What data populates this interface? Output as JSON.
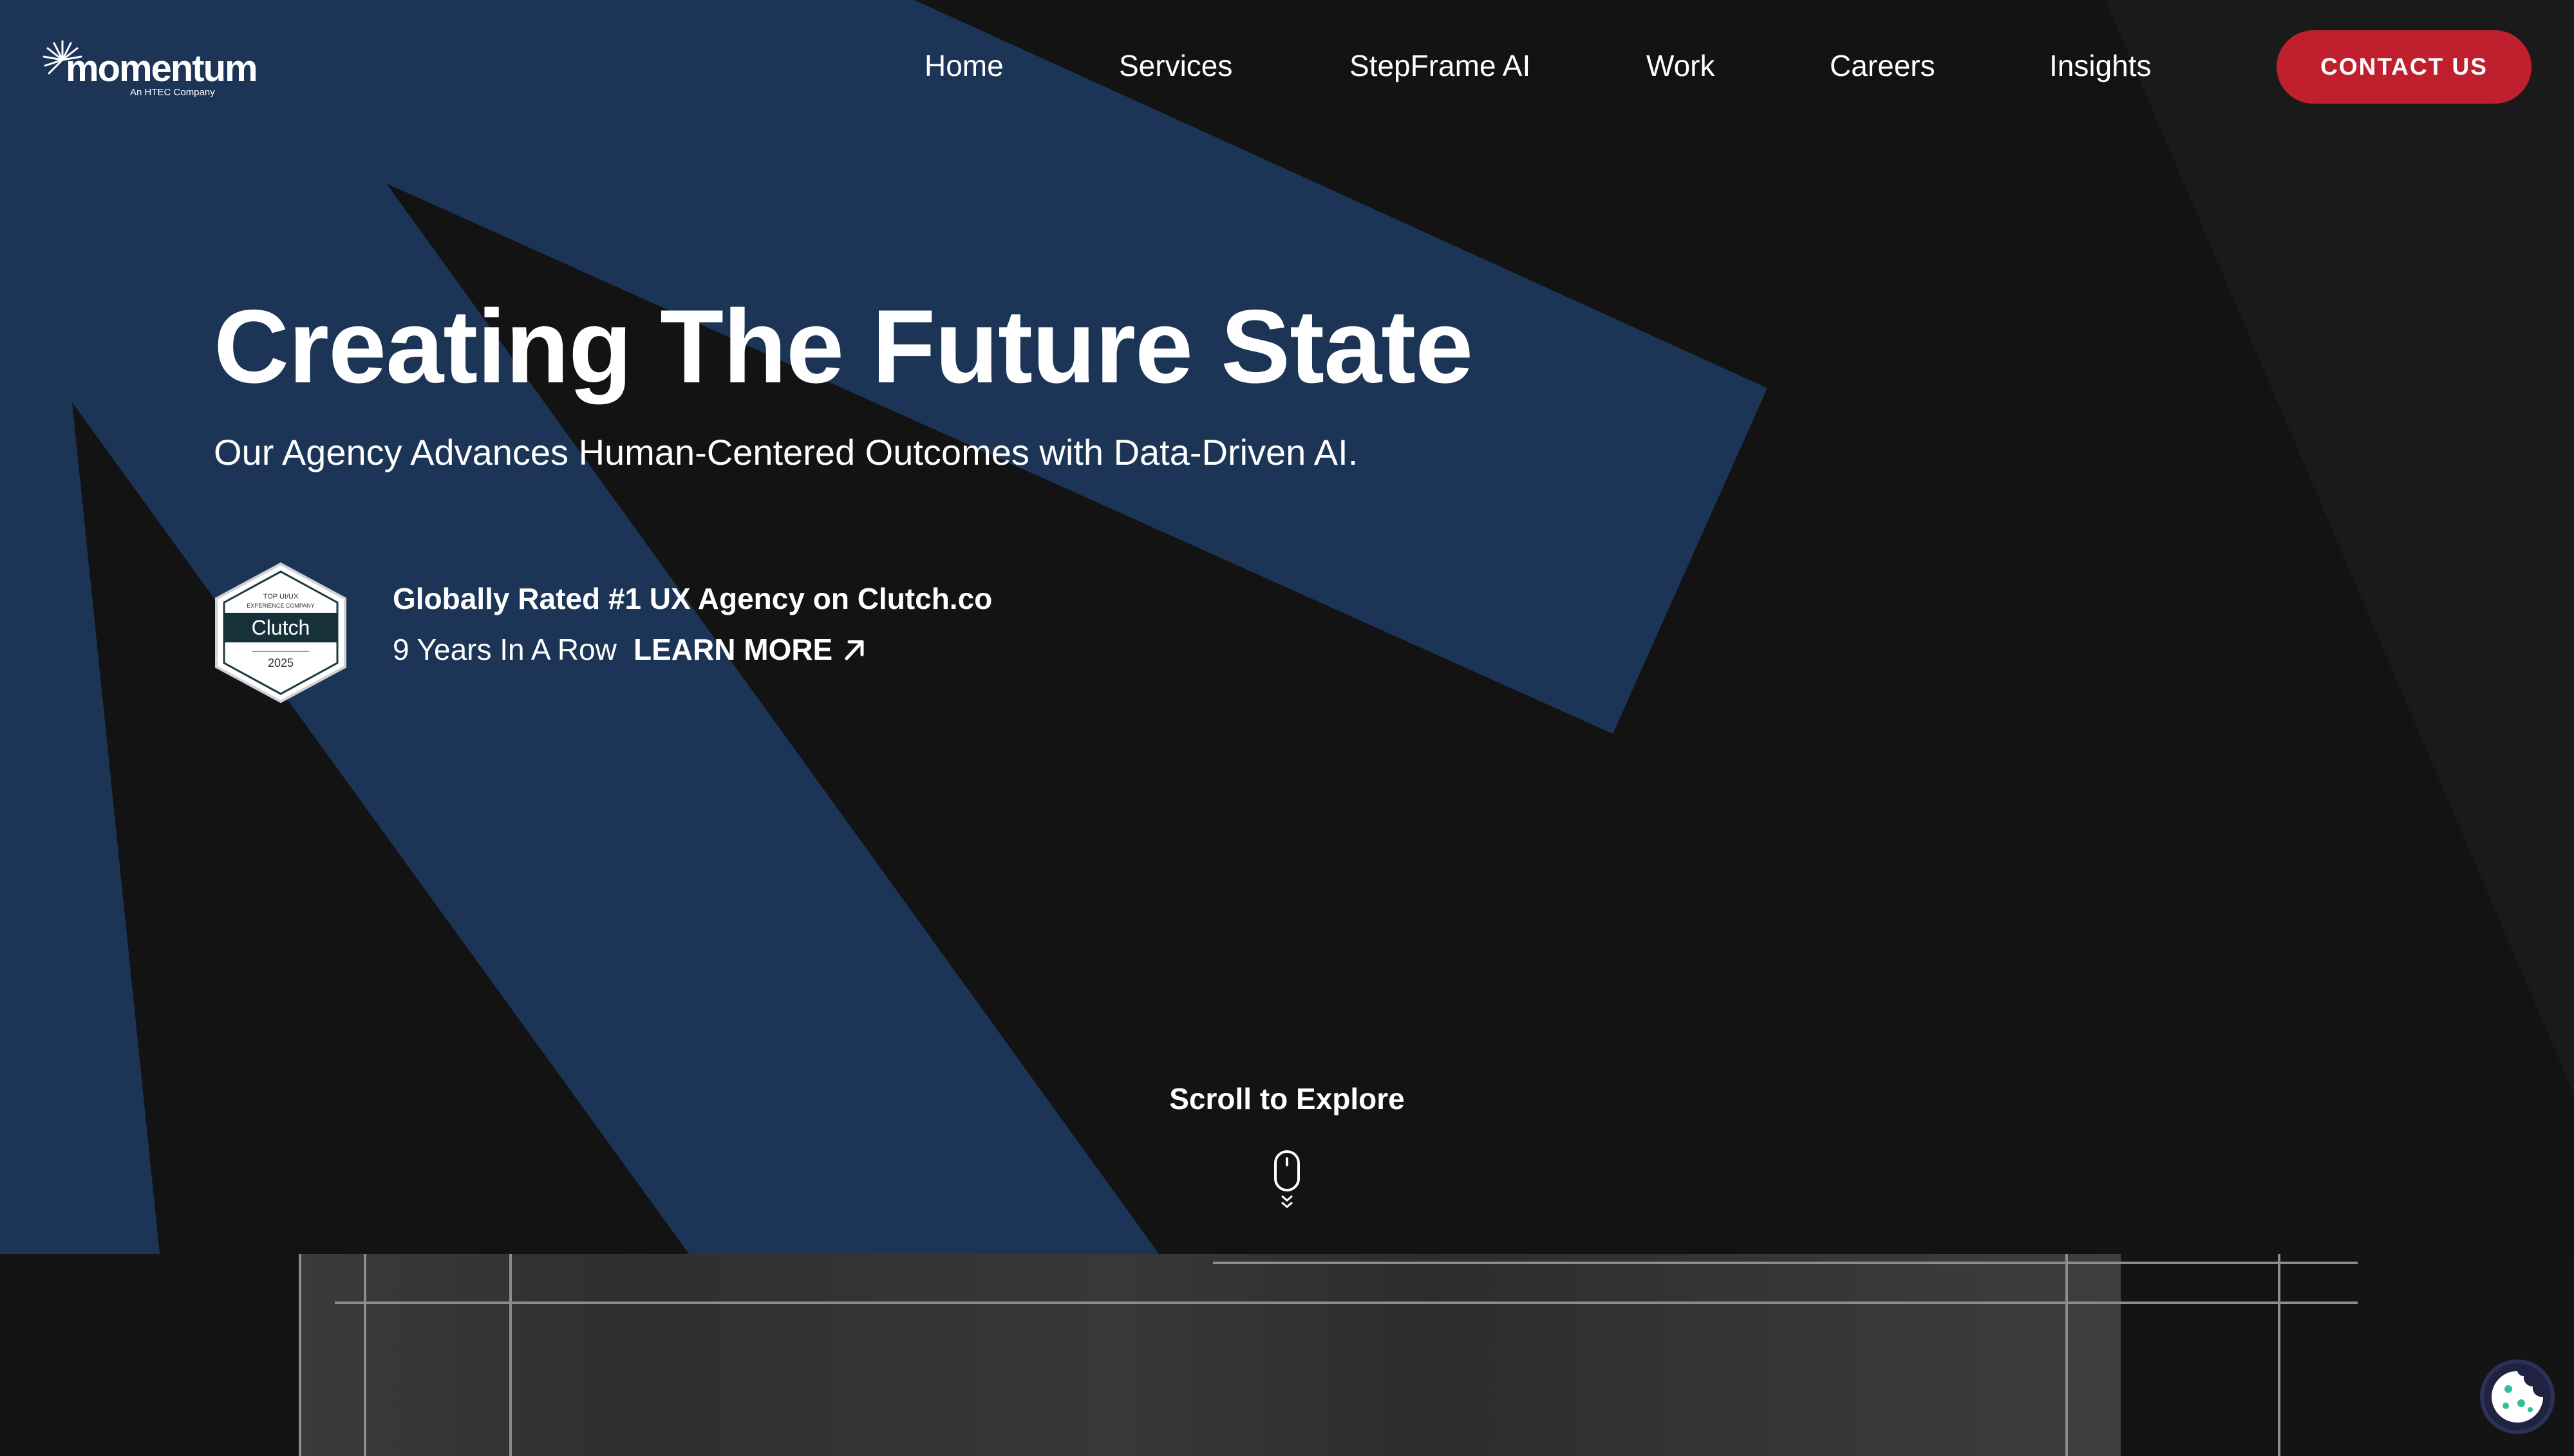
{
  "header": {
    "logo": {
      "wordmark": "momentum",
      "tagline": "An HTEC Company"
    },
    "nav": [
      {
        "label": "Home"
      },
      {
        "label": "Services"
      },
      {
        "label": "StepFrame AI"
      },
      {
        "label": "Work"
      },
      {
        "label": "Careers"
      },
      {
        "label": "Insights"
      }
    ],
    "contact_label": "CONTACT US"
  },
  "hero": {
    "headline": "Creating The Future State",
    "subheadline": "Our Agency Advances Human-Centered Outcomes with Data-Driven AI.",
    "award": {
      "badge": {
        "top_line": "TOP UI/UX",
        "second_line": "EXPERIENCE COMPANY",
        "brand": "Clutch",
        "year": "2025"
      },
      "title": "Globally Rated #1 UX Agency on Clutch.co",
      "subtitle": "9 Years In A Row",
      "learn_more_label": "LEARN MORE",
      "learn_more_icon": "arrow-up-right-icon"
    },
    "scroll_label": "Scroll to Explore",
    "scroll_icon": "mouse-scroll-icon"
  },
  "cookie_icon": "cookie-icon",
  "colors": {
    "background": "#131313",
    "accent_blue": "#1d3557",
    "cta_red": "#c0202d",
    "text": "#ffffff"
  }
}
